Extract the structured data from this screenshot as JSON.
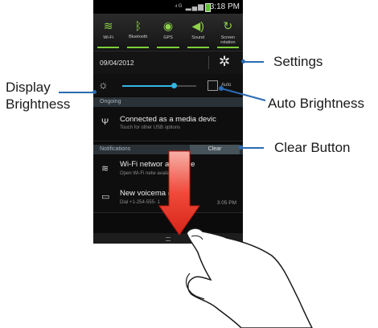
{
  "status_bar": {
    "time": "3:18 PM",
    "icons": "⁴ᴳ ▂▄▆"
  },
  "toggles": [
    {
      "label": "Wi-Fi",
      "icon": "wifi-icon",
      "glyph": "≋"
    },
    {
      "label": "Bluetooth",
      "icon": "bluetooth-icon",
      "glyph": "ᛒ"
    },
    {
      "label": "GPS",
      "icon": "gps-icon",
      "glyph": "◉"
    },
    {
      "label": "Sound",
      "icon": "sound-icon",
      "glyph": "◀)"
    },
    {
      "label": "Screen rotation",
      "icon": "rotation-icon",
      "glyph": "↻"
    }
  ],
  "date_row": {
    "date": "09/04/2012",
    "settings_icon": "gear-icon",
    "settings_glyph": "✲"
  },
  "brightness": {
    "level": 0.7,
    "auto_label": "Auto",
    "sun_glyph": "☼"
  },
  "ongoing": {
    "header": "Ongoing",
    "title": "Connected as a media devic",
    "subtitle": "Touch for other USB options",
    "icon_glyph": "Ψ"
  },
  "notifications": {
    "header": "Notifications",
    "clear_label": "Clear",
    "items": [
      {
        "title": "Wi-Fi networ     available",
        "subtitle": "Open Wi-Fi netw       available",
        "time": "",
        "icon_glyph": "≋"
      },
      {
        "title": "New voicema     (1)",
        "subtitle": "Dial +1-254-555-    1",
        "time": "3:05 PM",
        "icon_glyph": "▭"
      }
    ]
  },
  "callouts": {
    "settings": "Settings",
    "display_brightness_1": "Display",
    "display_brightness_2": "Brightness",
    "auto_brightness": "Auto Brightness",
    "clear_button": "Clear Button"
  },
  "colors": {
    "accent_green": "#7fcf3a",
    "slider_blue": "#33b5e5",
    "callout_blue": "#2a6bb3",
    "arrow_red": "#e8322a"
  }
}
